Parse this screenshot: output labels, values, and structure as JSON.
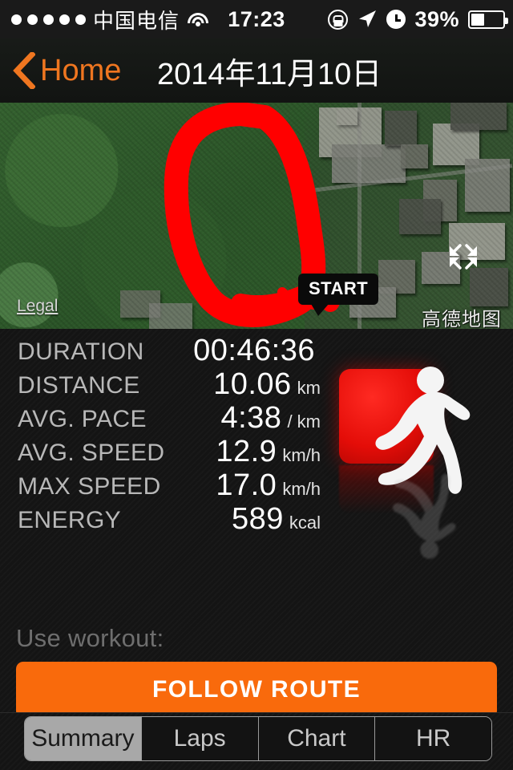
{
  "statusbar": {
    "signal_dots": 5,
    "carrier": "中国电信",
    "wifi_icon": "wifi-icon",
    "time": "17:23",
    "rotation_lock_icon": "rotation-lock-icon",
    "location_icon": "location-arrow-icon",
    "alarm_icon": "alarm-clock-icon",
    "battery_percent": "39%",
    "battery_level": 39
  },
  "navbar": {
    "back_label": "Home",
    "back_icon": "chevron-left-icon",
    "title": "2014年11月10日",
    "accent_color": "#ef7620"
  },
  "map": {
    "start_marker": "START",
    "legal_link": "Legal",
    "attribution": "高德地图",
    "expand_icon": "expand-fullscreen-icon",
    "route_color": "#ff0000"
  },
  "stats": [
    {
      "label": "DURATION",
      "value": "00:46:36",
      "unit": ""
    },
    {
      "label": "DISTANCE",
      "value": "10.06",
      "unit": "km"
    },
    {
      "label": "AVG. PACE",
      "value": "4:38",
      "unit": "/ km"
    },
    {
      "label": "AVG. SPEED",
      "value": "12.9",
      "unit": "km/h"
    },
    {
      "label": "MAX SPEED",
      "value": "17.0",
      "unit": "km/h"
    },
    {
      "label": "ENERGY",
      "value": "589",
      "unit": "kcal"
    }
  ],
  "logo": {
    "icon": "running-man-logo",
    "square_color": "#e40d08"
  },
  "actions": {
    "use_workout_label": "Use workout:",
    "follow_route_label": "FOLLOW ROUTE",
    "button_color": "#f96a0c"
  },
  "tabs": [
    {
      "label": "Summary",
      "active": true
    },
    {
      "label": "Laps",
      "active": false
    },
    {
      "label": "Chart",
      "active": false
    },
    {
      "label": "HR",
      "active": false
    }
  ]
}
